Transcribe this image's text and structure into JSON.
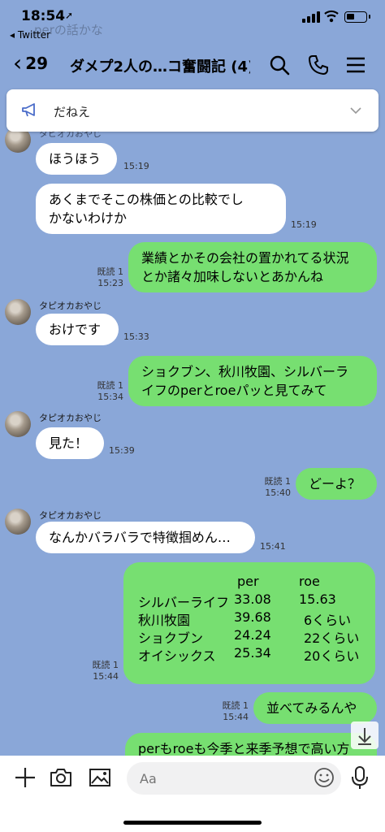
{
  "status": {
    "time": "18:54",
    "back_app": "◂ Twitter"
  },
  "faded": {
    "top_text": "perの話かな"
  },
  "header": {
    "back_count": "29",
    "title": "ダメプ2人の…コ奮闘記 (4)"
  },
  "announcement": {
    "text": "だねえ"
  },
  "sender_name": "タピオカおやじ",
  "messages": [
    {
      "text": "ほうほう",
      "time": "15:19"
    },
    {
      "text": "あくまでそこの株価との比較でし\nかないわけか",
      "time": "15:19"
    },
    {
      "text": "業績とかその会社の置かれてる状況\nとか諸々加味しないとあかんね",
      "read": "既読 1",
      "time": "15:23"
    },
    {
      "text": "おけです",
      "time": "15:33"
    },
    {
      "text": "ショクブン、秋川牧園、シルバーラ\nイフのperとroeパッと見てみて",
      "read": "既読 1",
      "time": "15:34"
    },
    {
      "text": "見た！",
      "time": "15:39"
    },
    {
      "text": "どーよ？",
      "read": "既読 1",
      "time": "15:40"
    },
    {
      "text": "なんかバラバラで特徴掴めん…",
      "time": "15:41"
    },
    {
      "read": "既読 1",
      "time": "15:44"
    },
    {
      "text": "並べてみるんや",
      "read": "既読 1",
      "time": "15:44"
    },
    {
      "text": "perもroeも今季と来季予想で高い方"
    }
  ],
  "stock_table": {
    "headers": [
      "per",
      "roe"
    ],
    "rows": [
      [
        "シルバーライフ",
        "33.08",
        "15.63"
      ],
      [
        "秋川牧園",
        "39.68",
        "6くらい"
      ],
      [
        "ショクブン",
        "24.24",
        "22くらい"
      ],
      [
        "オイシックス",
        "25.34",
        "20くらい"
      ]
    ]
  },
  "input": {
    "placeholder": "Aa"
  }
}
